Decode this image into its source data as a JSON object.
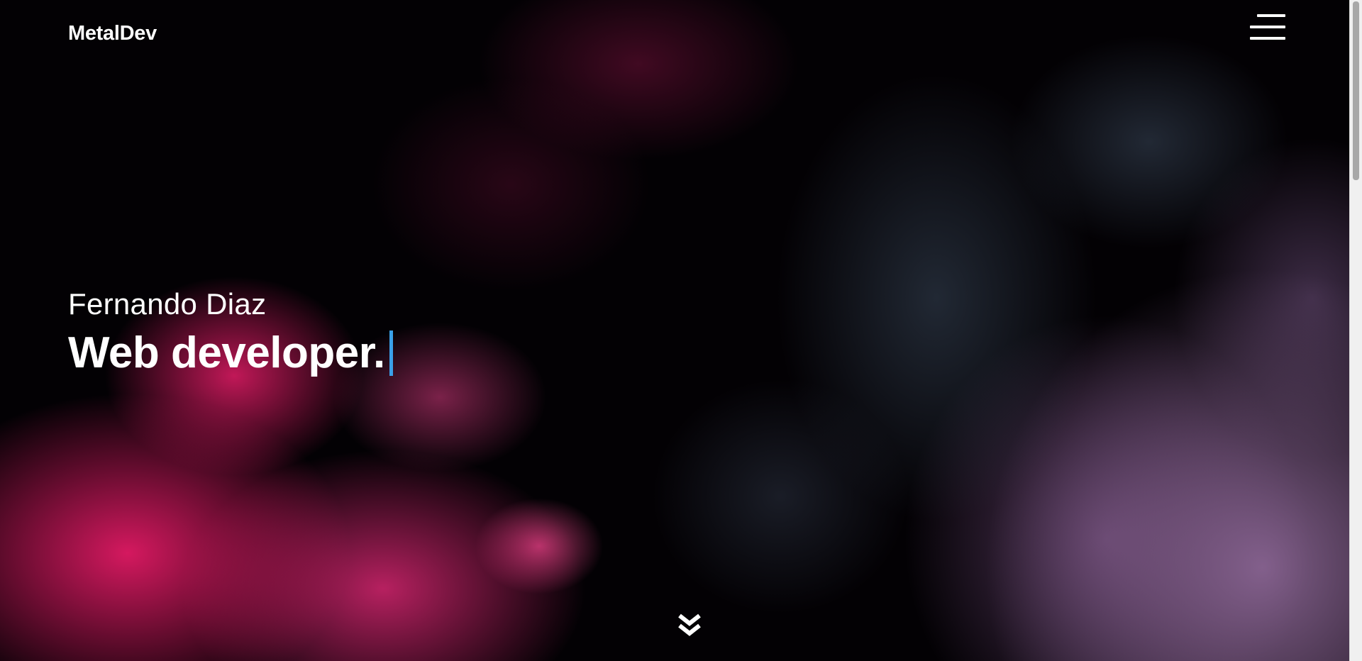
{
  "header": {
    "brand": "MetalDev",
    "menu_icon": "hamburger-menu-icon"
  },
  "hero": {
    "name": "Fernando Diaz",
    "title": "Web developer.",
    "cursor_color": "#3aa0e8",
    "scroll_icon": "double-chevron-down-icon"
  },
  "colors": {
    "background": "#030104",
    "text": "#ffffff",
    "accent_pink": "#e21c66",
    "accent_lilac": "#966ea0"
  }
}
